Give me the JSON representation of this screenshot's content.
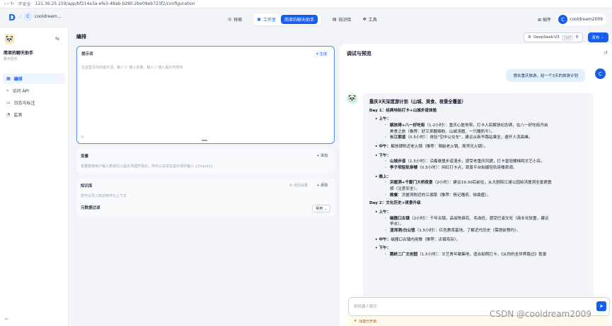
{
  "browser": {
    "security": "不安全",
    "url": "121.36.25.159/app/bf214a3a-efe3-48ab-b280-2be09eb723f2/configuration"
  },
  "nav": {
    "workspace": "cooldream...",
    "workspace_initial": "C",
    "explore": "探索",
    "studio": "工作室",
    "app_chip": "简单的聊天助手",
    "knowledge": "知识库",
    "tools": "工具",
    "plugins": "插件",
    "user_initial": "C",
    "user_name": "cooldream2009"
  },
  "sidebar": {
    "app_name": "简单的聊天助手",
    "app_type": "聊天助手",
    "items": [
      {
        "label": "编排",
        "icon": "orchestrate-icon"
      },
      {
        "label": "访问 API",
        "icon": "api-icon"
      },
      {
        "label": "日志与标注",
        "icon": "logs-icon"
      },
      {
        "label": "监测",
        "icon": "monitor-icon"
      }
    ]
  },
  "main": {
    "title": "编排",
    "prompt": {
      "label": "提示词",
      "generate": "生成",
      "placeholder": "在这里写你的提示词，输入'{' 插入变量、输入'/' 插入提示内容块",
      "count": "0"
    },
    "variables": {
      "label": "变量",
      "add": "添加",
      "desc": "变量能使用户输入表单引入提示词或开场白，你可以试试在提示词中输入 {{input}}"
    },
    "knowledge": {
      "label": "知识库",
      "recall": "召回设置",
      "add": "添加",
      "desc": "您可以导入知识库作为上下文",
      "filter_label": "元数据过滤",
      "filter_value": "禁用"
    }
  },
  "toolbar": {
    "model": "DeepSeek-V3",
    "model_tag": "CHAT",
    "publish": "发布"
  },
  "debug": {
    "title": "调试与预览",
    "user_message": "想去重庆旅游，给一个3天的旅游计划",
    "user_initial": "C",
    "answer": {
      "title": "重庆3天深度游计划（山城、美食、夜景全覆盖）",
      "day1": "Day 1：经典地标打卡+山城步道体验",
      "am1": "上午：",
      "am1_i1_b": "解放碑+八一好吃街",
      "am1_i1": "（1-2小时）：重庆心脏地带，打卡人民解放纪念碑，在八一好吃街开启",
      "am1_i1_c": "美食之旅（推荐：好又来酸辣粉、山城汤圆、一只酸奶牛）。",
      "am1_i2_b": "长江索道",
      "am1_i2": "（0.5小时）：体验\"空中公交车\"，建议从新华路站乘坐，避开人流高峰。",
      "noon1_b": "中午：",
      "noon1": "解放碑附近老火锅（推荐：珮姐老火锅、周师兄火锅）。",
      "pm1": "下午：",
      "pm1_i1_b": "山城步道",
      "pm1_i1": "（1.5小时）：沿着悬崖步道漫步，感受老重庆风貌，打卡皇冠楼梯和文艺小店。",
      "pm1_i2_b": "李子坝轻轨穿楼",
      "pm1_i2": "（0.5小时）：网红打卡点，观景平台拍摄轻轨穿楼奇观。",
      "eve1": "晚上：",
      "eve1_i1_b": "洪崖洞+千厮门大桥夜景",
      "eve1_i1": "（2小时）：建议19:30后前往，从大剧院江滩公园拍洪崖洞全景更震",
      "eve1_i1_c": "撼（注意安全）。",
      "eve1_i2_b": "晚餐",
      "eve1_i2": "：洪崖洞附近的江湖菜（推荐：杨记隆府、徐鼎盛）。",
      "day2": "Day 2：文化历史+夜景升级",
      "am2": "上午：",
      "am2_i1_b": "磁器口古镇",
      "am2_i1": "（2小时）：千年古镇，品尝陈麻花、毛血旺，感受巴渝文化（商业化较重，建议",
      "am2_i1_c": "早去）。",
      "am2_i2_b": "渣滓洞/白公馆",
      "am2_i2": "（1.5小时）：红色教育基地，了解近代历史（需提前预约）。",
      "noon2_b": "中午：",
      "noon2": "磁器口古镇内用餐（推荐：古镇鸡杂）。",
      "pm2": "下午：",
      "pm2_i1_b": "鹅岭二厂文创园",
      "pm2_i1": "（1.5小时）：文艺青年聚集地，适合拍照打卡，《从你的全世界路过》取景"
    },
    "input_placeholder": "和机器人聊天",
    "feature": "功能已开启"
  },
  "watermark": "CSDN @cooldream2009"
}
